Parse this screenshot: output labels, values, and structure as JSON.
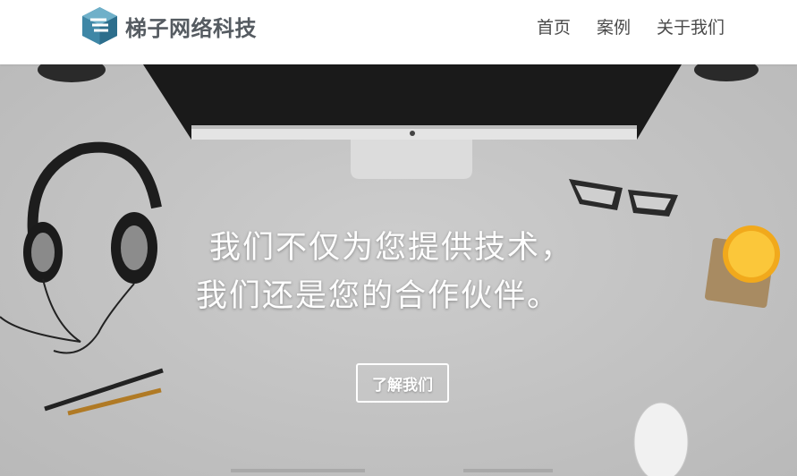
{
  "header": {
    "brand_name": "梯子网络科技",
    "logo_icon": "cube-logo-icon",
    "nav": [
      {
        "label": "首页"
      },
      {
        "label": "案例"
      },
      {
        "label": "关于我们"
      }
    ]
  },
  "hero": {
    "line1": "我们不仅为您提供技术，",
    "line2": "我们还是您的合作伙伴。",
    "cta_label": "了解我们"
  },
  "colors": {
    "logo_blue": "#3f87a6",
    "brand_text": "#555b61",
    "hero_bg": "#c8c8c8"
  }
}
